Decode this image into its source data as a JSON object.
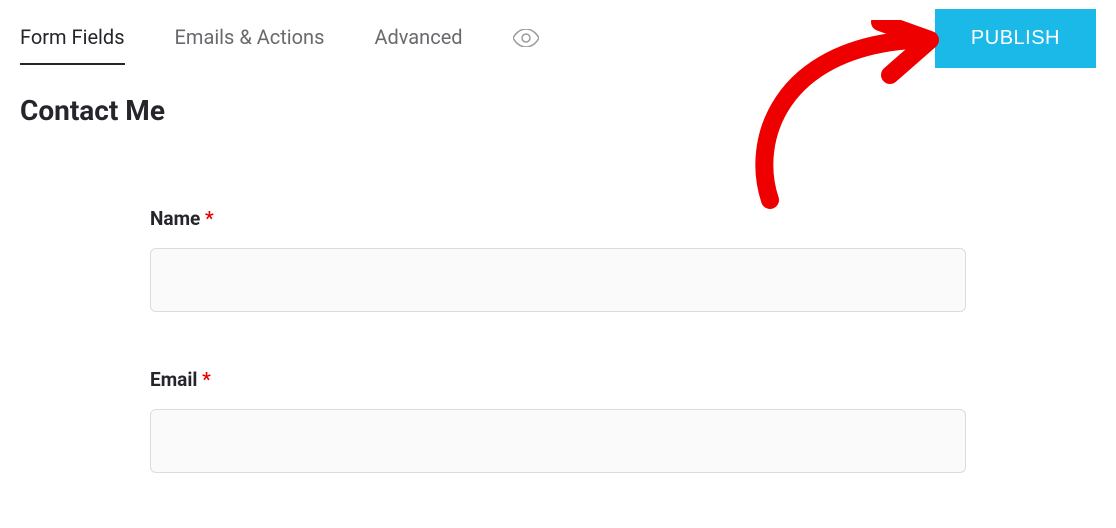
{
  "tabs": {
    "form_fields": "Form Fields",
    "emails_actions": "Emails & Actions",
    "advanced": "Advanced"
  },
  "header": {
    "publish_label": "PUBLISH"
  },
  "form": {
    "title": "Contact Me",
    "fields": {
      "name": {
        "label": "Name",
        "required_mark": "*"
      },
      "email": {
        "label": "Email",
        "required_mark": "*"
      }
    }
  }
}
